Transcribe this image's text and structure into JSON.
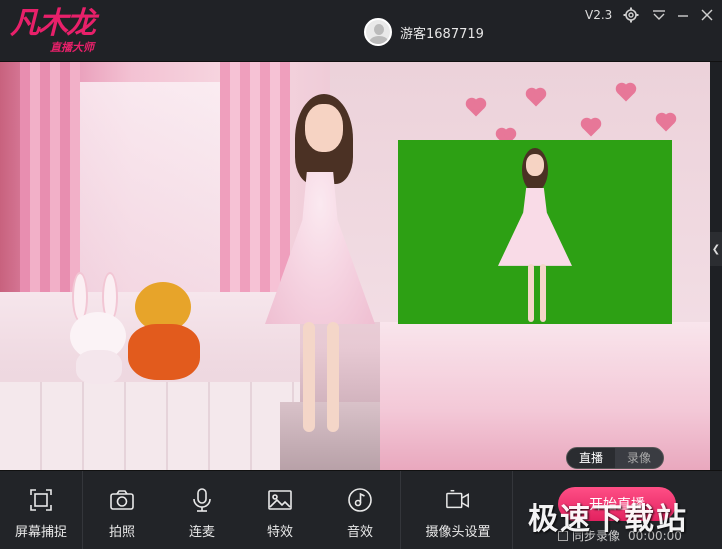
{
  "app": {
    "logo_text": "凡木龙",
    "logo_sub": "直播大师",
    "version": "V2.3",
    "username": "游客1687719"
  },
  "window_icons": [
    "gear-icon",
    "dropdown-icon",
    "minimize-icon",
    "close-icon"
  ],
  "stage": {
    "mode_live": "直播",
    "mode_record": "录像"
  },
  "toolbar": {
    "items": [
      {
        "label": "屏幕捕捉",
        "icon": "screen-capture-icon"
      },
      {
        "label": "拍照",
        "icon": "camera-icon"
      },
      {
        "label": "连麦",
        "icon": "microphone-icon"
      },
      {
        "label": "特效",
        "icon": "image-effect-icon"
      },
      {
        "label": "音效",
        "icon": "music-disc-icon"
      },
      {
        "label": "摄像头设置",
        "icon": "webcam-settings-icon"
      }
    ],
    "go_live_label": "开始直播",
    "sync_record_label": "同步录像",
    "record_timer": "00:00:00"
  },
  "watermark": "极速下载站",
  "colors": {
    "accent": "#e8206a",
    "greenscreen": "#2da014",
    "toolbar_bg": "#222428"
  }
}
